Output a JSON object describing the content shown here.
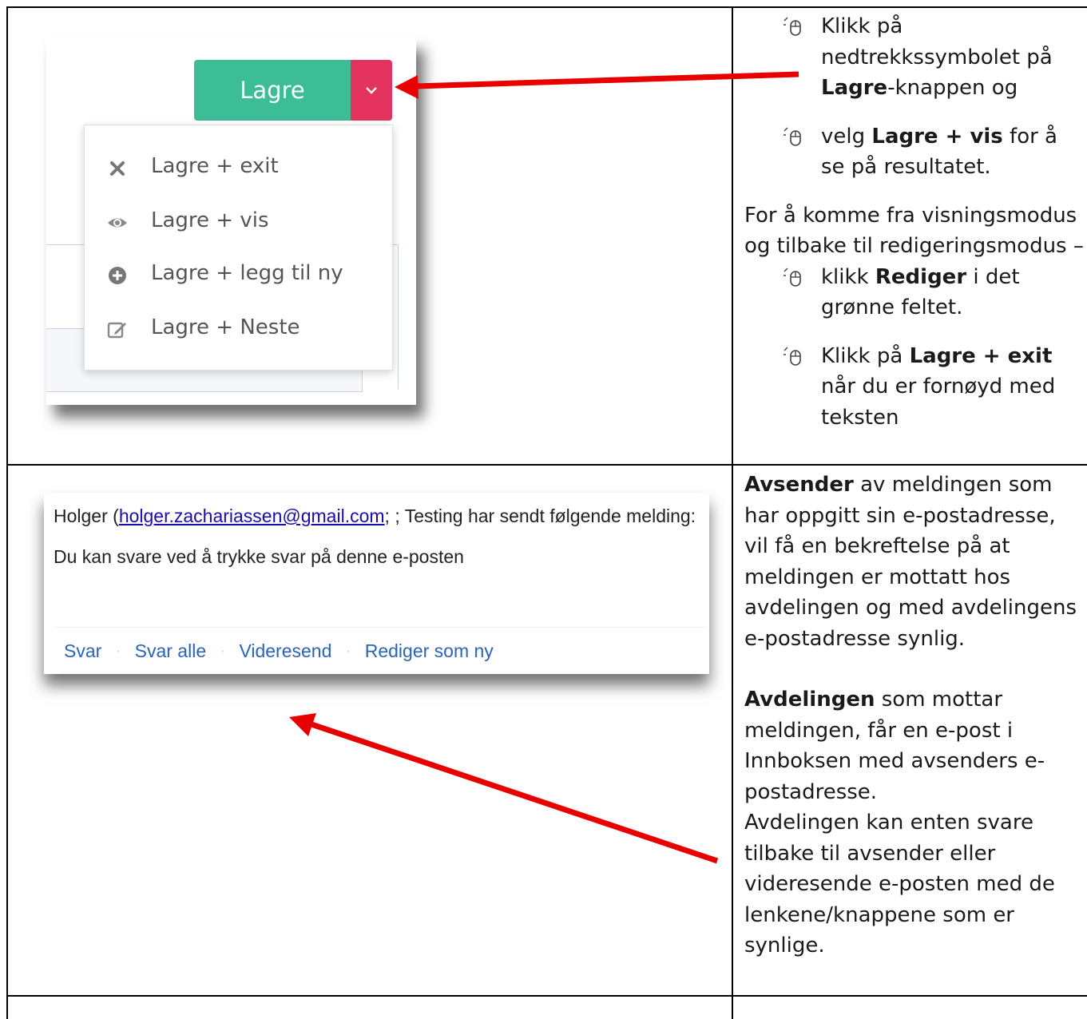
{
  "row1": {
    "screenshot": {
      "save_button_label": "Lagre",
      "menu_items": [
        {
          "label": "Lagre + exit",
          "icon": "close-icon"
        },
        {
          "label": "Lagre + vis",
          "icon": "eye-icon"
        },
        {
          "label": "Lagre + legg til ny",
          "icon": "plus-circle-icon"
        },
        {
          "label": "Lagre + Neste",
          "icon": "edit-icon"
        }
      ],
      "colors": {
        "save": "#3dbd95",
        "dropdown": "#e4335f"
      }
    },
    "instructions": {
      "bullet1": {
        "pre": "Klikk på nedtrekkssymbolet på ",
        "bold": "Lagre",
        "post": "-knappen og"
      },
      "bullet2": {
        "pre": "velg ",
        "bold": "Lagre + vis",
        "post": " for å se på resultatet."
      },
      "paragraph": "For å komme fra visningsmodus og tilbake til redigeringsmodus –",
      "bullet3": {
        "pre": "klikk ",
        "bold": "Rediger",
        "post": " i det grønne feltet."
      },
      "bullet4": {
        "pre": "Klikk på ",
        "bold": "Lagre + exit",
        "post": " når du er fornøyd med teksten"
      }
    }
  },
  "row2": {
    "email": {
      "sender_name": "Holger (",
      "sender_email": "holger.zachariassen@gmail.com",
      "subject_tail": "; ; Testing har sendt følgende melding:",
      "body": "Du kan svare ved å trykke svar på denne e-posten",
      "actions": [
        "Svar",
        "Svar alle",
        "Videresend",
        "Rediger som ny"
      ]
    },
    "text": {
      "p1_bold": "Avsender",
      "p1_rest": " av meldingen som har oppgitt sin e-postadresse, vil få en bekreftelse på at meldingen er mottatt hos avdelingen og med avdelingens e-postadresse synlig.",
      "p2_bold": "Avdelingen",
      "p2_rest": " som mottar meldingen, får en e-post i Innboksen med avsenders e-postadresse.",
      "p3": "Avdelingen kan enten svare tilbake til avsender eller videresende e-posten med de lenkene/knappene som er synlige."
    }
  }
}
